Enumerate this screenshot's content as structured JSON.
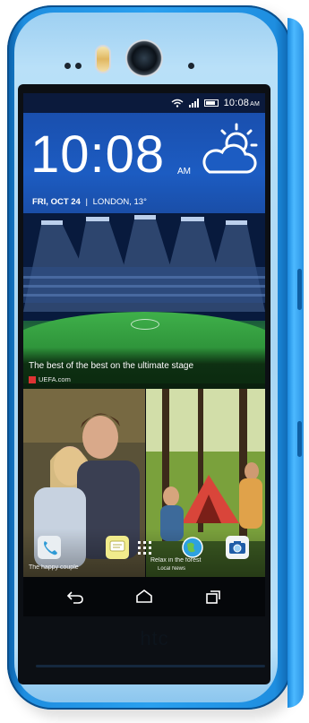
{
  "device": {
    "brand_logo": "htc",
    "body_color": "#2aa0ef",
    "front_color": "#b9e0f8"
  },
  "status_bar": {
    "time": "10:08",
    "ampm": "AM",
    "icons": [
      "wifi-icon",
      "signal-icon",
      "battery-icon"
    ]
  },
  "clock_widget": {
    "time": "10:08",
    "ampm": "AM",
    "day_date": "FRI, OCT 24",
    "city": "LONDON, 13°",
    "weather_icon": "partly-cloudy-icon"
  },
  "news_tile": {
    "headline": "The best of the best on the ultimate stage",
    "source": "UEFA.com"
  },
  "photo_tiles": {
    "left_label": "The happy couple",
    "right_label": "Relax in the forest",
    "right_sublabel": "Local News"
  },
  "nav_bar": {
    "buttons": [
      "back-icon",
      "home-icon",
      "recent-apps-icon"
    ]
  }
}
